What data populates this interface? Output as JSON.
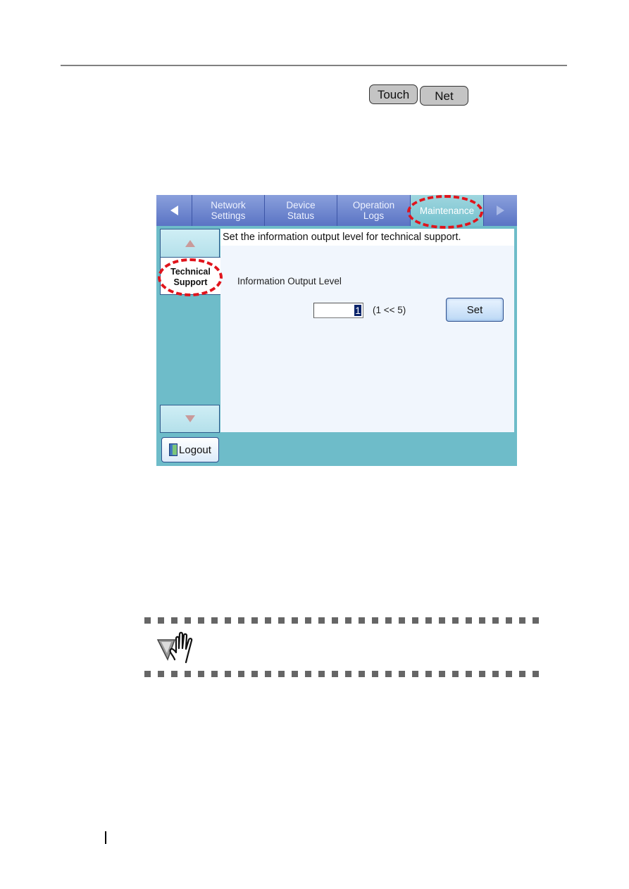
{
  "header_badges": {
    "touch": "Touch",
    "net": "Net"
  },
  "screen": {
    "tabs": [
      {
        "label": "Network\nSettings",
        "line1": "Network",
        "line2": "Settings",
        "active": false
      },
      {
        "label": "Device\nStatus",
        "line1": "Device",
        "line2": "Status",
        "active": false
      },
      {
        "label": "Operation\nLogs",
        "line1": "Operation",
        "line2": "Logs",
        "active": false
      },
      {
        "label": "Maintenance",
        "active": true
      }
    ],
    "sidebar": {
      "items": [
        {
          "line1": "Technical",
          "line2": "Support",
          "selected": true
        }
      ]
    },
    "content": {
      "heading": "Set the information output level for technical support.",
      "field_label": "Information Output Level",
      "level_value": "1",
      "range_hint": "(1 << 5)",
      "set_label": "Set"
    },
    "logout_label": "Logout"
  },
  "icons": {
    "prev": "triangle-left-icon",
    "next": "triangle-right-icon",
    "scroll_up": "triangle-up-icon",
    "scroll_down": "triangle-down-icon",
    "logout": "door-icon",
    "hint": "hand-stop-icon"
  },
  "colors": {
    "screen_bg": "#6ebcc9",
    "tab_bg": "#6f86cf",
    "highlight": "#e0141c",
    "content_bg": "#f1f6fd"
  }
}
